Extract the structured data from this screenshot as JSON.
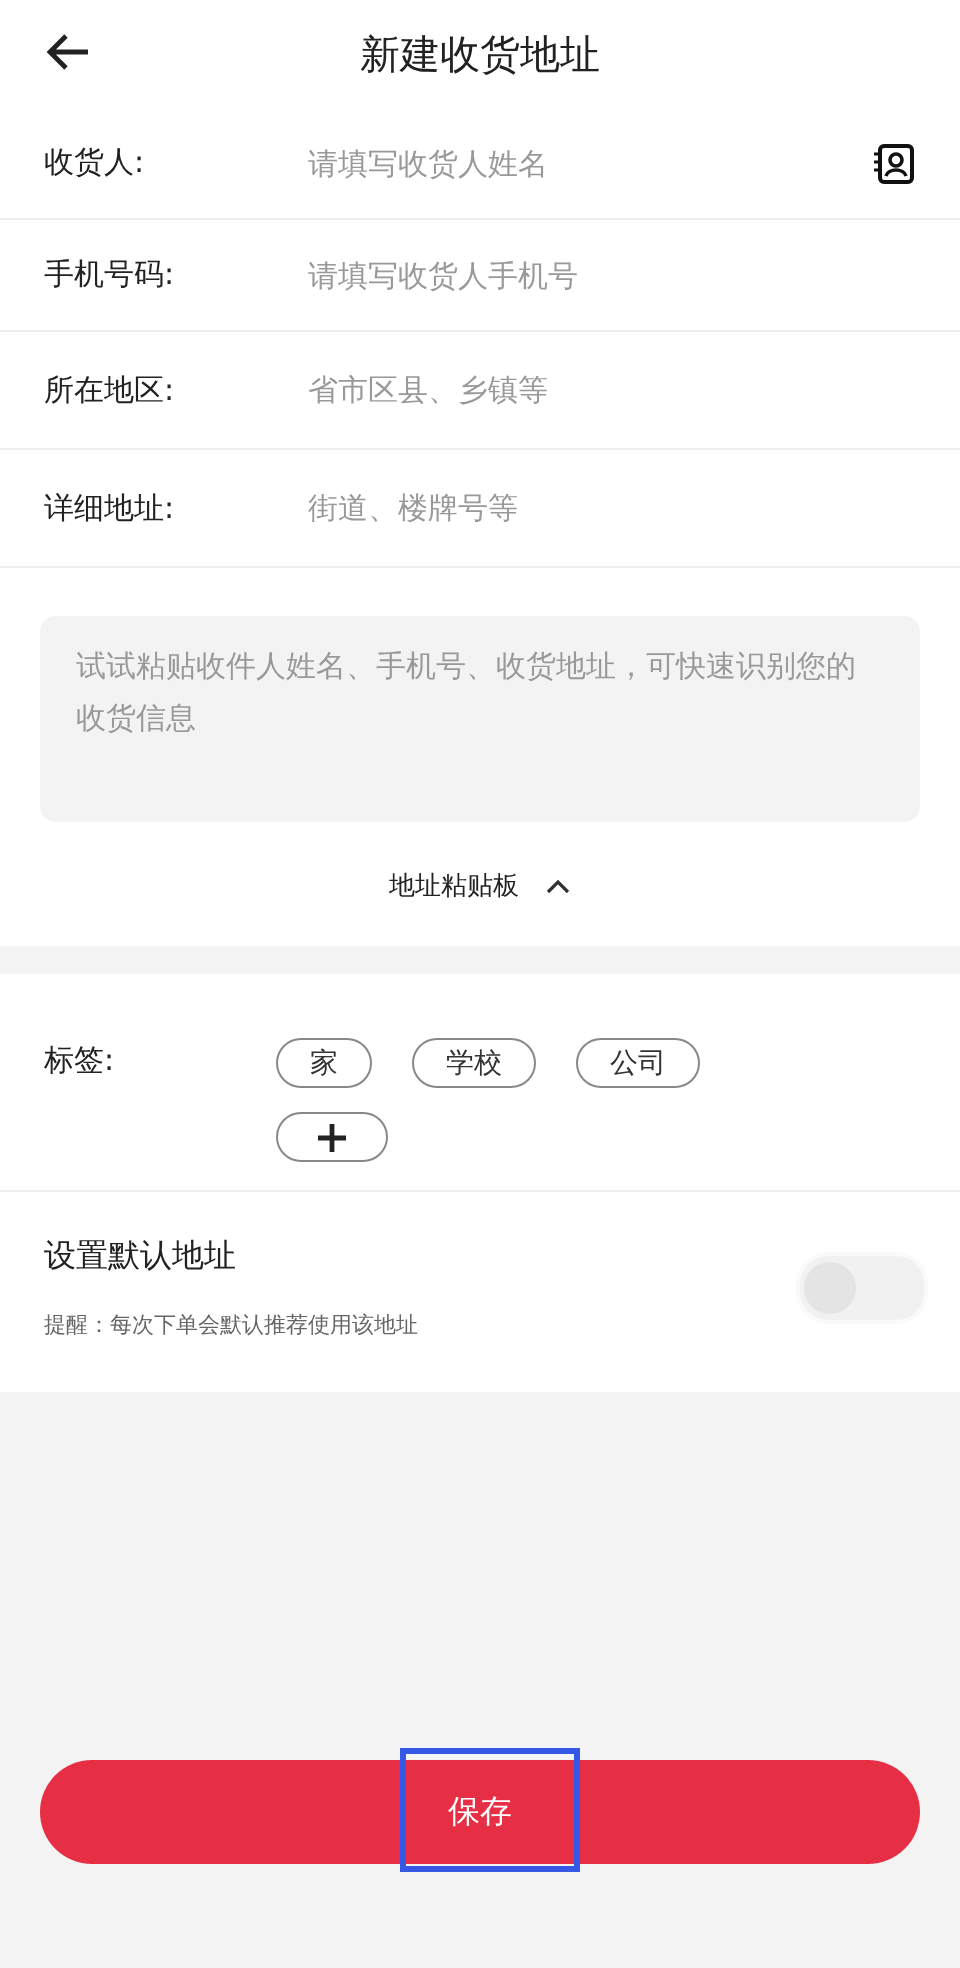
{
  "header": {
    "title": "新建收货地址"
  },
  "fields": [
    {
      "label": "收货人:",
      "placeholder": "请填写收货人姓名",
      "contact_picker": true
    },
    {
      "label": "手机号码:",
      "placeholder": "请填写收货人手机号",
      "contact_picker": false
    },
    {
      "label": "所在地区:",
      "placeholder": "省市区县、乡镇等",
      "contact_picker": false
    },
    {
      "label": "详细地址:",
      "placeholder": "街道、楼牌号等",
      "contact_picker": false
    }
  ],
  "paste_box": {
    "placeholder": "试试粘贴收件人姓名、手机号、收货地址，可快速识别您的收货信息"
  },
  "clipboard_toggle": {
    "label": "地址粘贴板",
    "expanded": true
  },
  "tags": {
    "label": "标签:",
    "items": [
      {
        "label": "家",
        "selected": false
      },
      {
        "label": "学校",
        "selected": false
      },
      {
        "label": "公司",
        "selected": false
      }
    ]
  },
  "default_address": {
    "title": "设置默认地址",
    "hint": "提醒：每次下单会默认推荐使用该地址",
    "on": false
  },
  "save_button": {
    "label": "保存"
  }
}
